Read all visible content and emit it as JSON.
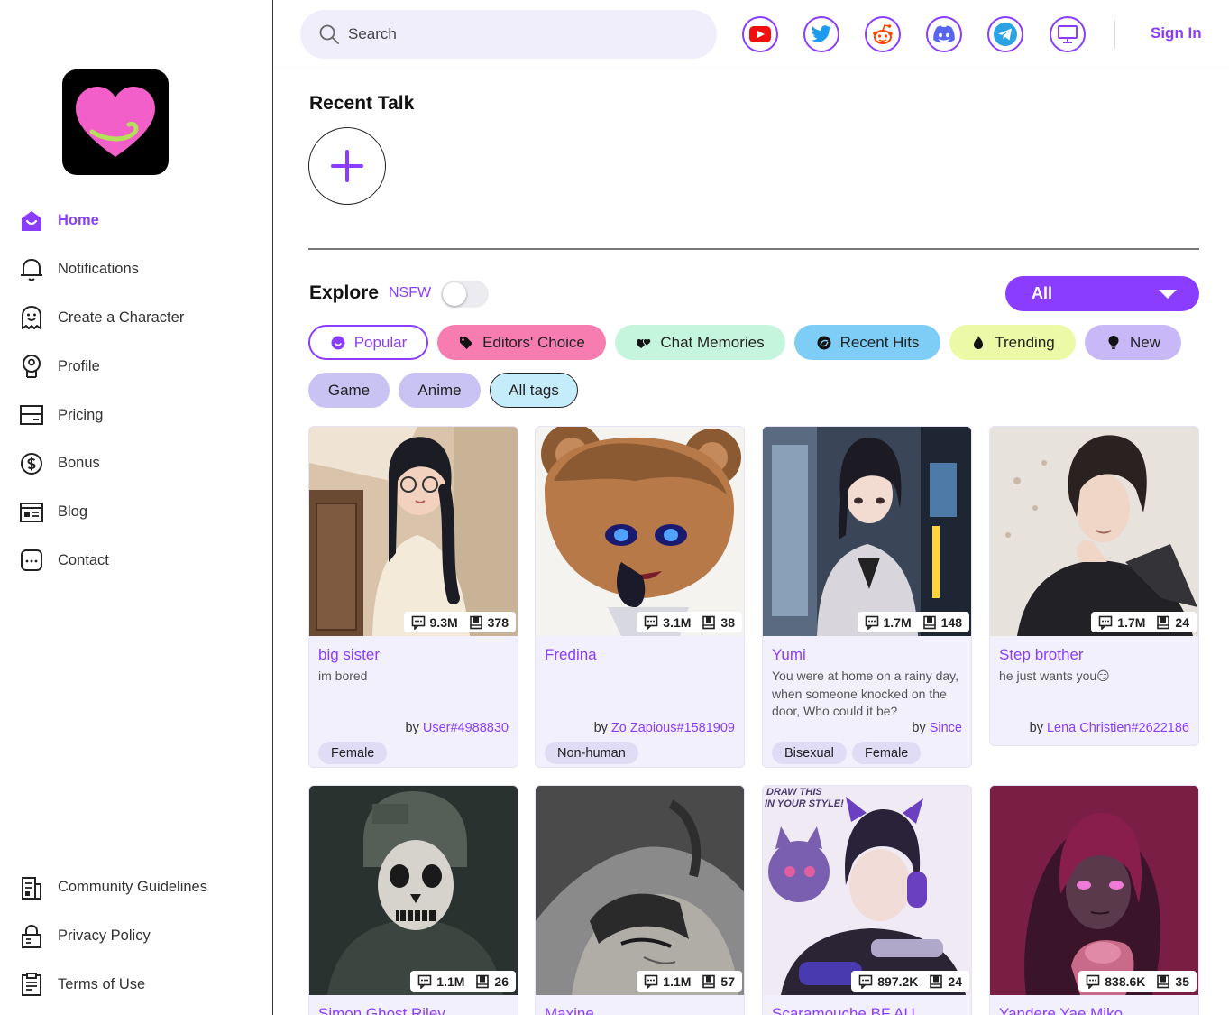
{
  "sidebar": {
    "nav": [
      {
        "label": "Home",
        "icon": "home-icon",
        "active": true
      },
      {
        "label": "Notifications",
        "icon": "bell-icon"
      },
      {
        "label": "Create a Character",
        "icon": "ghost-icon"
      },
      {
        "label": "Profile",
        "icon": "profile-badge-icon"
      },
      {
        "label": "Pricing",
        "icon": "card-icon"
      },
      {
        "label": "Bonus",
        "icon": "dollar-icon"
      },
      {
        "label": "Blog",
        "icon": "blog-icon"
      },
      {
        "label": "Contact",
        "icon": "chat-icon"
      }
    ],
    "bottom": [
      {
        "label": "Community Guidelines",
        "icon": "guidelines-icon"
      },
      {
        "label": "Privacy Policy",
        "icon": "lock-icon"
      },
      {
        "label": "Terms of Use",
        "icon": "clipboard-icon"
      }
    ]
  },
  "header": {
    "search_placeholder": "Search",
    "social": [
      "youtube-icon",
      "twitter-icon",
      "reddit-icon",
      "discord-icon",
      "telegram-icon",
      "desktop-icon"
    ],
    "sign_in": "Sign In"
  },
  "recent": {
    "title": "Recent Talk"
  },
  "explore": {
    "title": "Explore",
    "nsfw_label": "NSFW",
    "dropdown_value": "All",
    "filters": [
      {
        "label": "Popular",
        "icon": "smile-icon"
      },
      {
        "label": "Editors' Choice",
        "icon": "tag-icon"
      },
      {
        "label": "Chat Memories",
        "icon": "hearts-icon"
      },
      {
        "label": "Recent Hits",
        "icon": "swirl-icon"
      },
      {
        "label": "Trending",
        "icon": "fire-icon"
      },
      {
        "label": "New",
        "icon": "bulb-icon"
      }
    ],
    "categories": [
      "Game",
      "Anime",
      "All tags"
    ]
  },
  "cards": [
    {
      "name": "big sister",
      "desc": "im bored",
      "by_prefix": "by ",
      "author": "User#4988830",
      "chats": "9.3M",
      "saves": "378",
      "tags": [
        "Female"
      ]
    },
    {
      "name": "Fredina",
      "desc": "",
      "by_prefix": "by ",
      "author": "Zo Zapious#1581909",
      "chats": "3.1M",
      "saves": "38",
      "tags": [
        "Non-human"
      ]
    },
    {
      "name": "Yumi",
      "desc": "You were at home on a rainy day, when someone knocked on the door, Who could it be?",
      "by_prefix": "by ",
      "author": "Since",
      "chats": "1.7M",
      "saves": "148",
      "tags": [
        "Bisexual",
        "Female"
      ]
    },
    {
      "name": "Step brother",
      "desc": "he just wants you😏",
      "by_prefix": "by ",
      "author": "Lena Christien#2622186",
      "chats": "1.7M",
      "saves": "24",
      "tags": []
    },
    {
      "name": "Simon Ghost Riley",
      "chats": "1.1M",
      "saves": "26"
    },
    {
      "name": "Maxine",
      "chats": "1.1M",
      "saves": "57"
    },
    {
      "name": "Scaramouche BF AU",
      "chats": "897.2K",
      "saves": "24"
    },
    {
      "name": "Yandere Yae Miko",
      "chats": "838.6K",
      "saves": "35"
    }
  ],
  "colors": {
    "accent": "#8b3dff",
    "popular_border": "#8b3dff",
    "editors": "#f77db0",
    "memories": "#c6f5dd",
    "recent_hits": "#7dcdf7",
    "trending": "#ecf9a6",
    "new": "#c9b8f7",
    "category": "#c9c3f3",
    "alltags": "#c5ecfb"
  },
  "artwork_texts": [
    "DRAW THIS",
    "IN YOUR STYLE!"
  ]
}
